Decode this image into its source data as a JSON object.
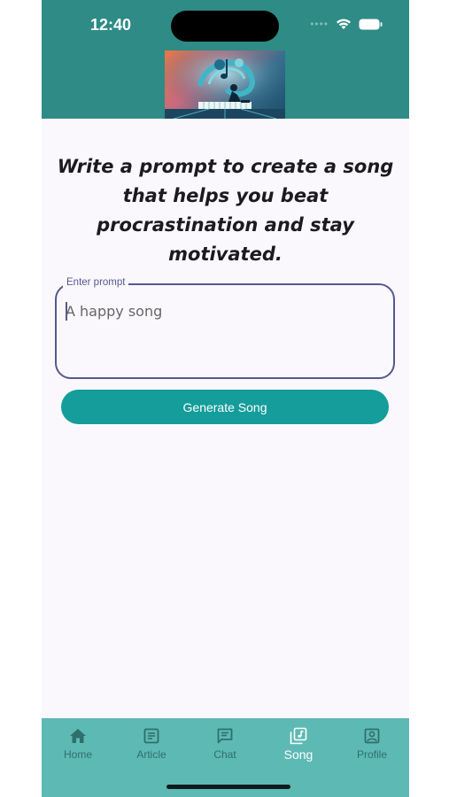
{
  "status": {
    "time": "12:40"
  },
  "main": {
    "title": "Write a prompt to create a song that helps you beat procrastination and stay motivated.",
    "prompt_label": "Enter prompt",
    "prompt_placeholder": "A happy song",
    "prompt_value": "",
    "generate_label": "Generate Song"
  },
  "nav": {
    "items": [
      {
        "label": "Home",
        "icon": "home-icon",
        "active": false
      },
      {
        "label": "Article",
        "icon": "article-icon",
        "active": false
      },
      {
        "label": "Chat",
        "icon": "chat-icon",
        "active": false
      },
      {
        "label": "Song",
        "icon": "song-icon",
        "active": true
      },
      {
        "label": "Profile",
        "icon": "profile-icon",
        "active": false
      }
    ]
  },
  "colors": {
    "header": "#2e8b85",
    "accent": "#149d9b",
    "navbar": "#5db9b4",
    "field_border": "#55598f",
    "background": "#fbf8fd"
  }
}
